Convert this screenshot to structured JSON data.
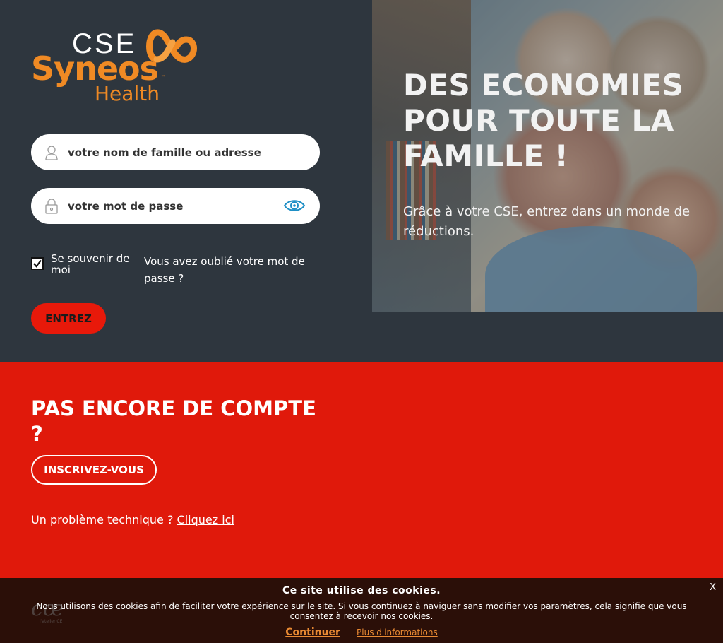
{
  "logo": {
    "cse": "CSE",
    "brand": "Syneos",
    "tm": "™",
    "sub": "Health"
  },
  "login": {
    "username_placeholder": "votre nom de famille ou adresse mail",
    "password_placeholder": "votre mot de passe",
    "remember_label": "Se souvenir de moi",
    "remember_checked": true,
    "forgot_link": "Vous avez oublié votre mot de passe ?",
    "submit_label": "ENTREZ"
  },
  "hero": {
    "title": "DES ECONOMIES POUR TOUTE LA FAMILLE !",
    "subtitle": "Grâce à votre CSE, entrez dans un monde de réductions."
  },
  "signup": {
    "heading": "PAS ENCORE DE COMPTE ?",
    "button_label": "INSCRIVEZ-VOUS",
    "tech_text": "Un problème technique ?",
    "tech_link": "Cliquez ici"
  },
  "cookie": {
    "title": "Ce site utilise des cookies.",
    "text": "Nous utilisons des cookies afin de faciliter votre expérience sur le site. Si vous continuez à naviguer sans modifier vos paramètres, cela signifie que vous consentez à recevoir nos cookies.",
    "continue_label": "Continuer",
    "more_label": "Plus d'informations",
    "close_label": "X"
  },
  "colors": {
    "background": "#2e363e",
    "accent_red": "#e0190b",
    "brand_orange": "#f08a24",
    "cookie_bg": "#2b0f08"
  }
}
